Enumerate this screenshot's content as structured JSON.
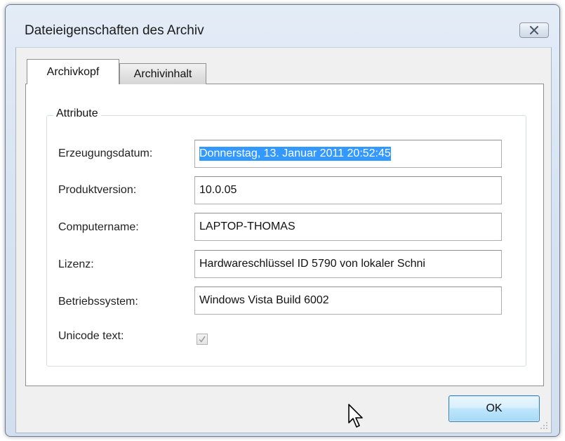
{
  "window": {
    "title": "Dateieigenschaften des Archiv"
  },
  "tabs": [
    {
      "label": "Archivkopf",
      "selected": true
    },
    {
      "label": "Archivinhalt",
      "selected": false
    }
  ],
  "group": {
    "legend": "Attribute",
    "fields": [
      {
        "label": "Erzeugungsdatum:",
        "value": "Donnerstag, 13. Januar 2011 20:52:45",
        "selected": true
      },
      {
        "label": "Produktversion:",
        "value": "10.0.05"
      },
      {
        "label": "Computername:",
        "value": "LAPTOP-THOMAS"
      },
      {
        "label": "Lizenz:",
        "value": "Hardwareschlüssel ID 5790 von lokaler Schni"
      },
      {
        "label": "Betriebssystem:",
        "value": "Windows Vista Build 6002"
      }
    ],
    "unicode": {
      "label": "Unicode text:",
      "checked": true,
      "enabled": false
    }
  },
  "buttons": {
    "ok_label": "OK"
  },
  "icons": {
    "close": "close-x-icon",
    "check": "checkmark-icon",
    "grip": "resize-grip-icon",
    "cursor": "mouse-pointer-icon"
  },
  "colors": {
    "selection": "#3399ff",
    "ok_border": "#3c7fb1"
  }
}
